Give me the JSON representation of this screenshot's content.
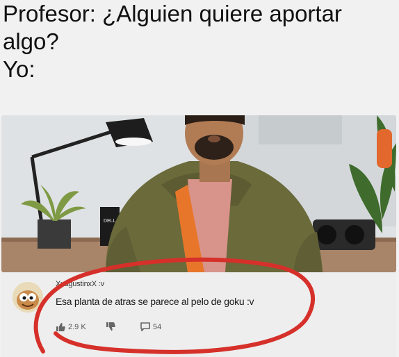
{
  "caption": {
    "line1": "Profesor: ¿Alguien quiere aportar",
    "line2": "algo?",
    "line3": "Yo:"
  },
  "photo": {
    "mug_text": "DELL"
  },
  "comment": {
    "username": "XxagustinxX :v",
    "text": "Esa planta de atras se parece al pelo de goku :v",
    "likes": "2.9 K",
    "replies": "54"
  },
  "colors": {
    "highlight_circle": "#d6302a",
    "jacket": "#6b6a3b",
    "background": "#f1f1f1"
  },
  "icons": [
    "thumbs-up-icon",
    "thumbs-down-icon",
    "comment-icon"
  ]
}
